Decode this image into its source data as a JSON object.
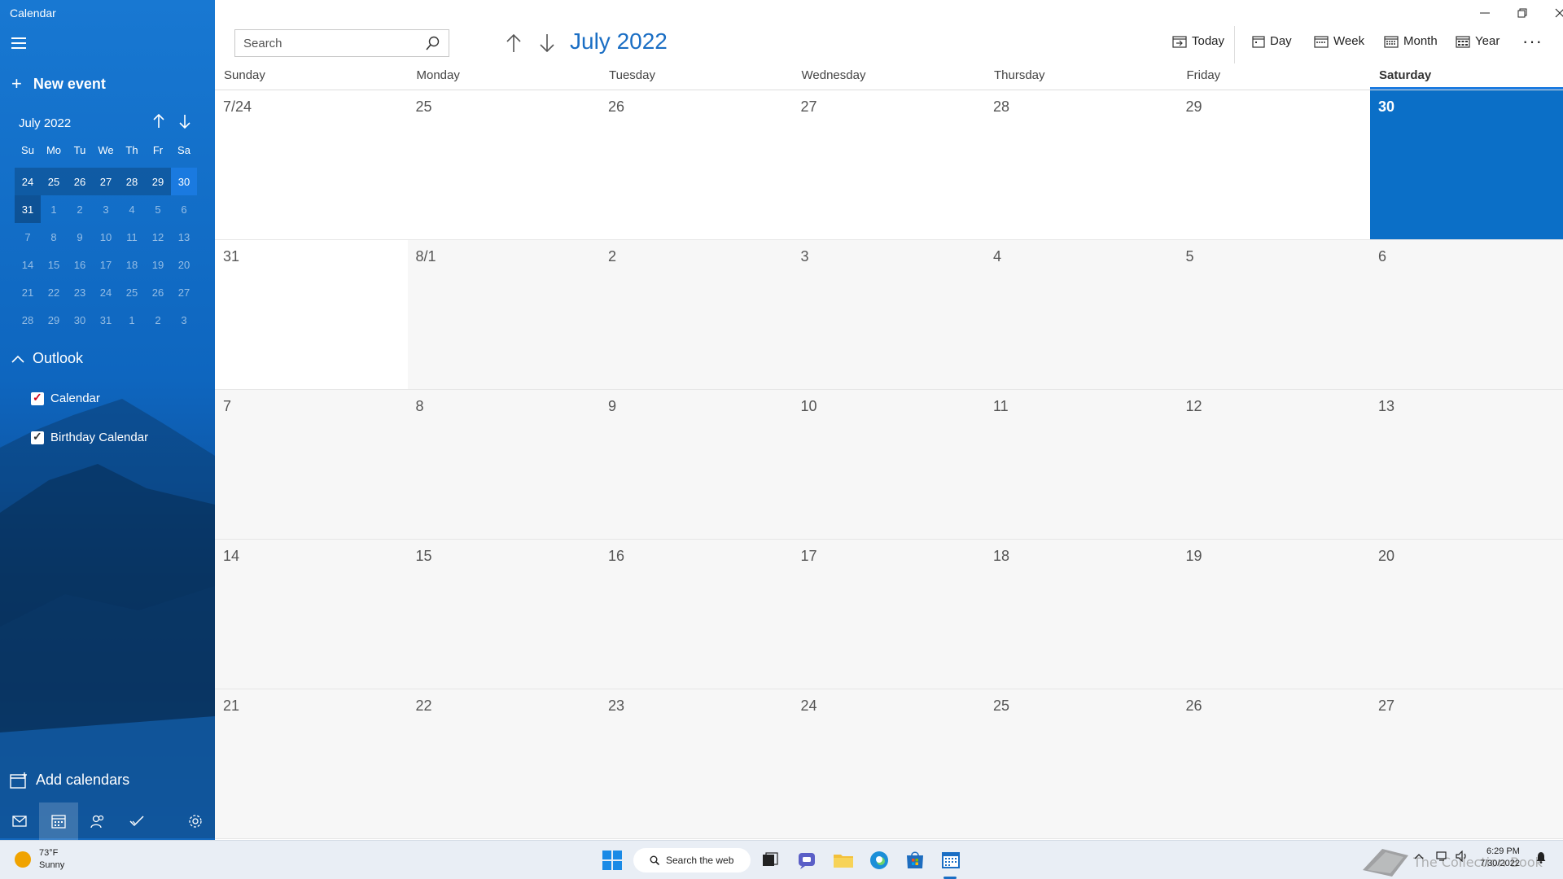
{
  "app": {
    "title": "Calendar"
  },
  "sidebar": {
    "new_event": "New event",
    "mini_calendar": {
      "header": "July 2022",
      "dow": [
        "Su",
        "Mo",
        "Tu",
        "We",
        "Th",
        "Fr",
        "Sa"
      ],
      "weeks": [
        [
          "24",
          "25",
          "26",
          "27",
          "28",
          "29",
          "30"
        ],
        [
          "31",
          "1",
          "2",
          "3",
          "4",
          "5",
          "6"
        ],
        [
          "7",
          "8",
          "9",
          "10",
          "11",
          "12",
          "13"
        ],
        [
          "14",
          "15",
          "16",
          "17",
          "18",
          "19",
          "20"
        ],
        [
          "21",
          "22",
          "23",
          "24",
          "25",
          "26",
          "27"
        ],
        [
          "28",
          "29",
          "30",
          "31",
          "1",
          "2",
          "3"
        ]
      ]
    },
    "outlook_label": "Outlook",
    "calendars": [
      {
        "label": "Calendar",
        "checked": true,
        "color": "#d0021b"
      },
      {
        "label": "Birthday Calendar",
        "checked": true,
        "color": "#333333"
      }
    ],
    "add_calendars": "Add calendars"
  },
  "toolbar": {
    "search_placeholder": "Search",
    "month_title": "July 2022",
    "today": "Today",
    "day": "Day",
    "week": "Week",
    "month": "Month",
    "year": "Year"
  },
  "calendar": {
    "weekdays": [
      "Sunday",
      "Monday",
      "Tuesday",
      "Wednesday",
      "Thursday",
      "Friday",
      "Saturday"
    ],
    "weeks": [
      [
        "7/24",
        "25",
        "26",
        "27",
        "28",
        "29",
        "30"
      ],
      [
        "31",
        "8/1",
        "2",
        "3",
        "4",
        "5",
        "6"
      ],
      [
        "7",
        "8",
        "9",
        "10",
        "11",
        "12",
        "13"
      ],
      [
        "14",
        "15",
        "16",
        "17",
        "18",
        "19",
        "20"
      ],
      [
        "21",
        "22",
        "23",
        "24",
        "25",
        "26",
        "27"
      ]
    ],
    "today_label": "30",
    "accent_color": "#0b6fc7"
  },
  "taskbar": {
    "weather_temp": "73°F",
    "weather_desc": "Sunny",
    "search_label": "Search the web",
    "time": "6:29 PM",
    "date": "7/30/2022"
  }
}
